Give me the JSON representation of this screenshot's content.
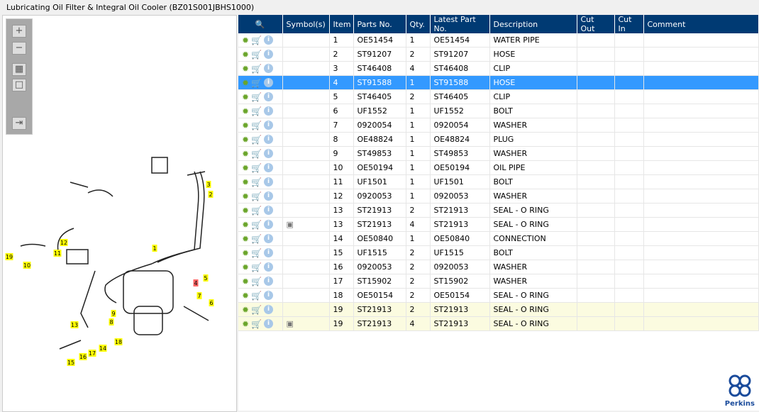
{
  "title": "Lubricating Oil Filter & Integral Oil Cooler (BZ01S001JBHS1000)",
  "toolbar": {
    "zoom_in": "+",
    "zoom_out": "−",
    "fit": "▦",
    "actual": "□",
    "export": "⇥"
  },
  "callouts": [
    {
      "n": "3"
    },
    {
      "n": "2"
    },
    {
      "n": "1"
    },
    {
      "n": "12"
    },
    {
      "n": "11"
    },
    {
      "n": "19"
    },
    {
      "n": "10"
    },
    {
      "n": "4",
      "highlight": true
    },
    {
      "n": "5"
    },
    {
      "n": "7"
    },
    {
      "n": "6"
    },
    {
      "n": "9"
    },
    {
      "n": "8"
    },
    {
      "n": "13"
    },
    {
      "n": "18"
    },
    {
      "n": "14"
    },
    {
      "n": "17"
    },
    {
      "n": "16"
    },
    {
      "n": "15"
    }
  ],
  "columns": [
    "",
    "Symbol(s)",
    "Item",
    "Parts No.",
    "Qty.",
    "Latest Part No.",
    "Description",
    "Cut Out",
    "Cut In",
    "Comment"
  ],
  "rows": [
    {
      "item": "1",
      "part": "OE51454",
      "qty": "1",
      "latest": "OE51454",
      "desc": "WATER PIPE"
    },
    {
      "item": "2",
      "part": "ST91207",
      "qty": "2",
      "latest": "ST91207",
      "desc": "HOSE"
    },
    {
      "item": "3",
      "part": "ST46408",
      "qty": "4",
      "latest": "ST46408",
      "desc": "CLIP"
    },
    {
      "item": "4",
      "part": "ST91588",
      "qty": "1",
      "latest": "ST91588",
      "desc": "HOSE",
      "selected": true
    },
    {
      "item": "5",
      "part": "ST46405",
      "qty": "2",
      "latest": "ST46405",
      "desc": "CLIP"
    },
    {
      "item": "6",
      "part": "UF1552",
      "qty": "1",
      "latest": "UF1552",
      "desc": "BOLT"
    },
    {
      "item": "7",
      "part": "0920054",
      "qty": "1",
      "latest": "0920054",
      "desc": "WASHER"
    },
    {
      "item": "8",
      "part": "OE48824",
      "qty": "1",
      "latest": "OE48824",
      "desc": "PLUG"
    },
    {
      "item": "9",
      "part": "ST49853",
      "qty": "1",
      "latest": "ST49853",
      "desc": "WASHER"
    },
    {
      "item": "10",
      "part": "OE50194",
      "qty": "1",
      "latest": "OE50194",
      "desc": "OIL PIPE"
    },
    {
      "item": "11",
      "part": "UF1501",
      "qty": "1",
      "latest": "UF1501",
      "desc": "BOLT"
    },
    {
      "item": "12",
      "part": "0920053",
      "qty": "1",
      "latest": "0920053",
      "desc": "WASHER"
    },
    {
      "item": "13",
      "part": "ST21913",
      "qty": "2",
      "latest": "ST21913",
      "desc": "SEAL - O RING"
    },
    {
      "item": "13",
      "part": "ST21913",
      "qty": "4",
      "latest": "ST21913",
      "desc": "SEAL - O RING",
      "symbol": true
    },
    {
      "item": "14",
      "part": "OE50840",
      "qty": "1",
      "latest": "OE50840",
      "desc": "CONNECTION"
    },
    {
      "item": "15",
      "part": "UF1515",
      "qty": "2",
      "latest": "UF1515",
      "desc": "BOLT"
    },
    {
      "item": "16",
      "part": "0920053",
      "qty": "2",
      "latest": "0920053",
      "desc": "WASHER"
    },
    {
      "item": "17",
      "part": "ST15902",
      "qty": "2",
      "latest": "ST15902",
      "desc": "WASHER"
    },
    {
      "item": "18",
      "part": "OE50154",
      "qty": "2",
      "latest": "OE50154",
      "desc": "SEAL - O RING"
    },
    {
      "item": "19",
      "part": "ST21913",
      "qty": "2",
      "latest": "ST21913",
      "desc": "SEAL - O RING",
      "highlight": true
    },
    {
      "item": "19",
      "part": "ST21913",
      "qty": "4",
      "latest": "ST21913",
      "desc": "SEAL - O RING",
      "symbol": true,
      "highlight": true
    }
  ],
  "brand": "Perkins",
  "colors": {
    "header": "#003a73",
    "selected": "#3399ff",
    "highlight": "#fbfbe0",
    "callout": "#ffff00",
    "callout_active": "#ff6666"
  }
}
